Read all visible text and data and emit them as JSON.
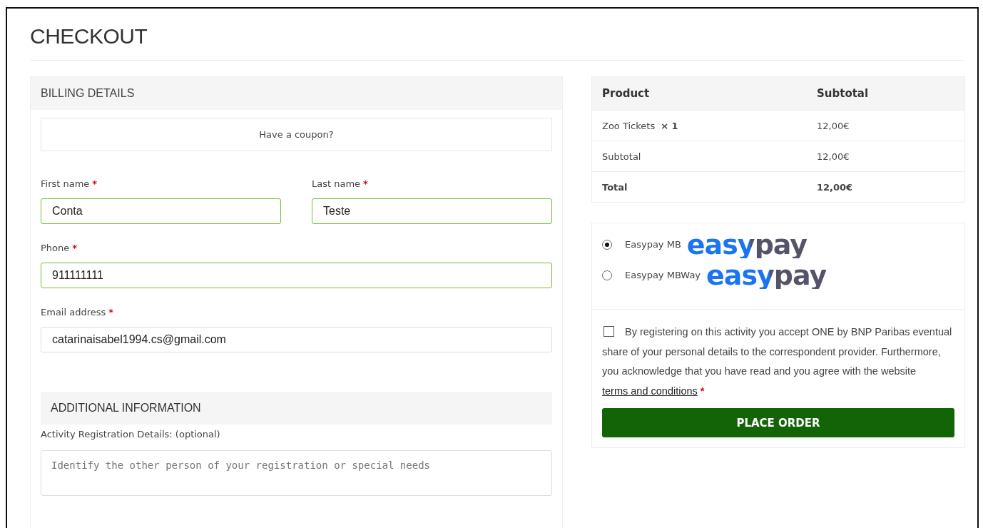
{
  "page_title": "CHECKOUT",
  "billing": {
    "title": "BILLING DETAILS",
    "coupon_link": "Have a coupon?",
    "field_rows": [
      [
        {
          "label": "First name",
          "required_mark": "*",
          "value": "Conta",
          "valid": true
        },
        {
          "label": "Last name",
          "required_mark": "*",
          "value": "Teste",
          "valid": true
        }
      ],
      [
        {
          "label": "Phone",
          "required_mark": "*",
          "value": "911111111",
          "valid": true
        }
      ],
      [
        {
          "label": "Email address",
          "required_mark": "*",
          "value": "catarinaisabel1994.cs@gmail.com",
          "valid": false
        }
      ]
    ]
  },
  "additional": {
    "title": "ADDITIONAL INFORMATION",
    "label": "Activity Registration Details: (optional)",
    "placeholder": "Identify the other person of your registration or special needs"
  },
  "order": {
    "columns": [
      "Product",
      "Subtotal"
    ],
    "rows": [
      {
        "kind": "item",
        "product": "Zoo Tickets",
        "quantity": "× 1",
        "amount": "12,00€"
      },
      {
        "kind": "subtotal",
        "product": "Subtotal",
        "amount": "12,00€"
      },
      {
        "kind": "total",
        "product": "Total",
        "amount": "12,00€"
      }
    ]
  },
  "payment_methods": [
    {
      "label": "Easypay MB",
      "logo": "easypay",
      "selected": true
    },
    {
      "label": "Easypay MBWay",
      "logo": "easypay",
      "selected": false
    }
  ],
  "terms": {
    "checked": false,
    "text": "By registering on this activity you accept ONE by BNP Paribas eventual share of your personal details to the correspondent provider. Furthermore, you acknowledge that you have read and you agree with the website",
    "link": "terms and conditions",
    "required_mark": "*"
  },
  "place_order": "PLACE ORDER"
}
